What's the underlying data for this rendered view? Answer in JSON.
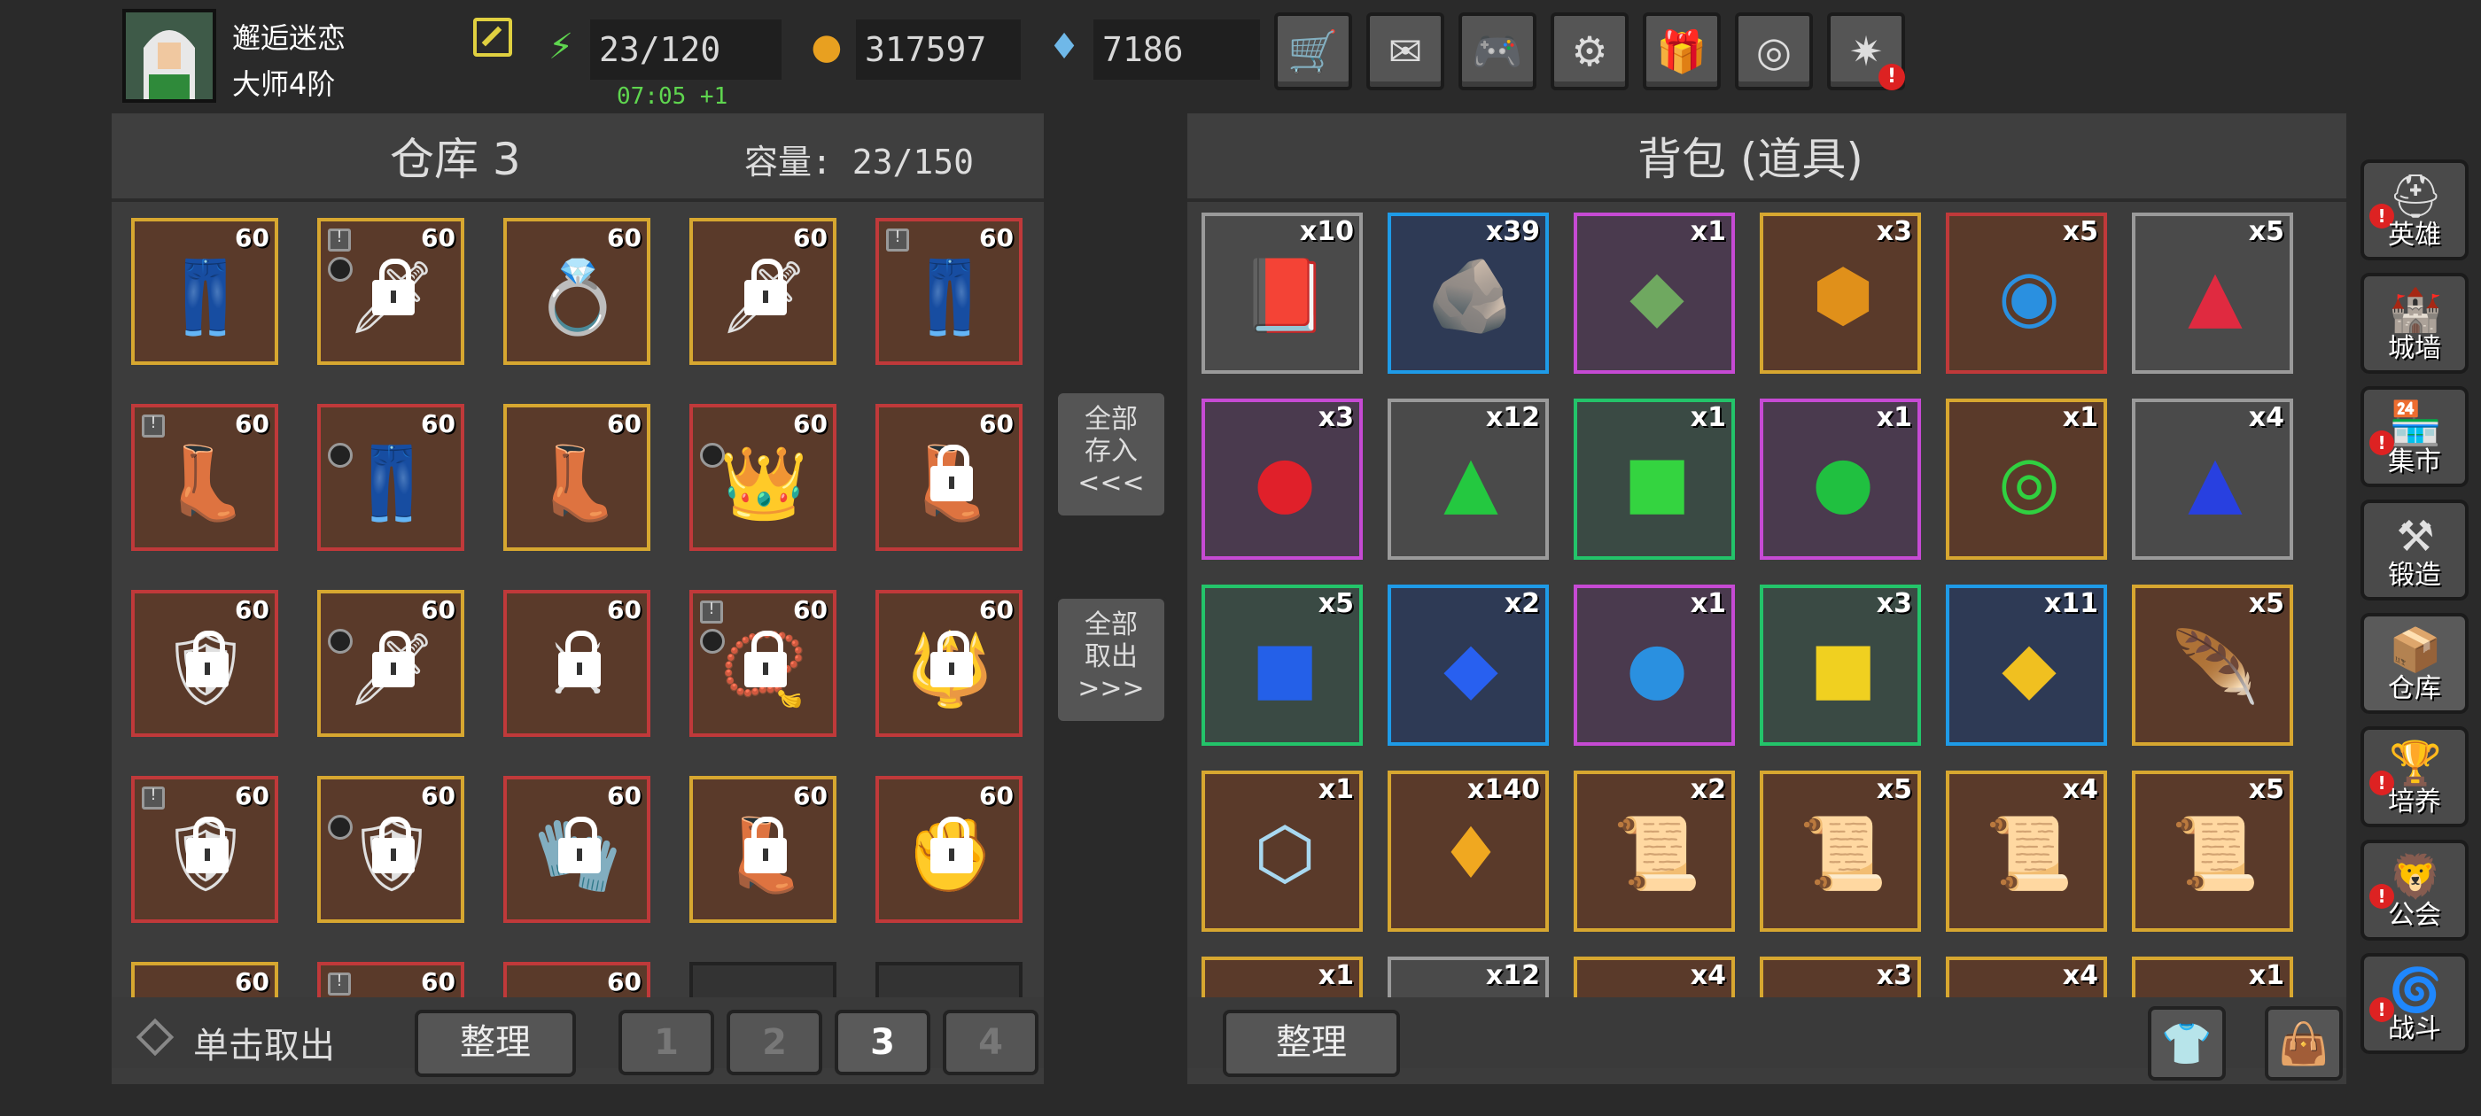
{
  "player": {
    "name": "邂逅迷恋",
    "rank": "大师4阶"
  },
  "stats": {
    "energy": "23/120",
    "gold": "317597",
    "gems": "7186",
    "timer": "07:05 +1"
  },
  "top_buttons": [
    {
      "name": "shop",
      "icon": "cart-icon"
    },
    {
      "name": "mail",
      "icon": "envelope-icon"
    },
    {
      "name": "controller",
      "icon": "gamepad-icon"
    },
    {
      "name": "settings",
      "icon": "gear-icon"
    },
    {
      "name": "gift",
      "icon": "gift-icon"
    },
    {
      "name": "camera",
      "icon": "aperture-icon"
    },
    {
      "name": "fireworks",
      "icon": "fireworks-icon"
    }
  ],
  "warehouse": {
    "title": "仓库 3",
    "capacity": "容量: 23/150",
    "slots": [
      {
        "level": "60",
        "rarity": "gold",
        "icon": "pants-icon",
        "locked": false,
        "mark": false,
        "circle": false
      },
      {
        "level": "60",
        "rarity": "gold",
        "icon": "staff-icon",
        "locked": true,
        "mark": true,
        "circle": true
      },
      {
        "level": "60",
        "rarity": "gold",
        "icon": "ring-icon",
        "locked": false,
        "mark": false,
        "circle": false
      },
      {
        "level": "60",
        "rarity": "gold",
        "icon": "staff-icon",
        "locked": true,
        "mark": false,
        "circle": false
      },
      {
        "level": "60",
        "rarity": "red",
        "icon": "pants-icon",
        "locked": false,
        "mark": true,
        "circle": false
      },
      {
        "level": "60",
        "rarity": "red",
        "icon": "boots-icon",
        "locked": false,
        "mark": true,
        "circle": false
      },
      {
        "level": "60",
        "rarity": "red",
        "icon": "pants-icon",
        "locked": false,
        "mark": false,
        "circle": true
      },
      {
        "level": "60",
        "rarity": "gold",
        "icon": "boots-icon",
        "locked": false,
        "mark": false,
        "circle": false
      },
      {
        "level": "60",
        "rarity": "red",
        "icon": "crown-icon",
        "locked": false,
        "mark": false,
        "circle": true
      },
      {
        "level": "60",
        "rarity": "red",
        "icon": "boots-icon",
        "locked": true,
        "mark": false,
        "circle": false
      },
      {
        "level": "60",
        "rarity": "red",
        "icon": "armor-icon",
        "locked": true,
        "mark": false,
        "circle": false
      },
      {
        "level": "60",
        "rarity": "gold",
        "icon": "staff-icon",
        "locked": true,
        "mark": false,
        "circle": true
      },
      {
        "level": "60",
        "rarity": "red",
        "icon": "sword-icon",
        "locked": true,
        "mark": false,
        "circle": false
      },
      {
        "level": "60",
        "rarity": "red",
        "icon": "necklace-icon",
        "locked": true,
        "mark": true,
        "circle": true
      },
      {
        "level": "60",
        "rarity": "red",
        "icon": "amulet-icon",
        "locked": true,
        "mark": false,
        "circle": false
      },
      {
        "level": "60",
        "rarity": "red",
        "icon": "armor-icon",
        "locked": true,
        "mark": true,
        "circle": false
      },
      {
        "level": "60",
        "rarity": "gold",
        "icon": "armor-icon",
        "locked": true,
        "mark": false,
        "circle": true
      },
      {
        "level": "60",
        "rarity": "red",
        "icon": "gloves-icon",
        "locked": true,
        "mark": false,
        "circle": false
      },
      {
        "level": "60",
        "rarity": "gold",
        "icon": "boots-icon",
        "locked": true,
        "mark": false,
        "circle": false
      },
      {
        "level": "60",
        "rarity": "red",
        "icon": "gauntlet-icon",
        "locked": true,
        "mark": false,
        "circle": false
      },
      {
        "level": "60",
        "rarity": "gold",
        "icon": "helmet-icon",
        "locked": false,
        "mark": false,
        "circle": false
      },
      {
        "level": "60",
        "rarity": "red",
        "icon": "armor-icon",
        "locked": false,
        "mark": true,
        "circle": false
      },
      {
        "level": "60",
        "rarity": "red",
        "icon": "helmet-icon",
        "locked": false,
        "mark": false,
        "circle": false
      },
      {
        "level": "",
        "rarity": "empty",
        "icon": "",
        "locked": false,
        "mark": false,
        "circle": false
      },
      {
        "level": "",
        "rarity": "empty",
        "icon": "",
        "locked": false,
        "mark": false,
        "circle": false
      }
    ],
    "click_take": "单击取出",
    "sort_label": "整理",
    "pages": [
      "1",
      "2",
      "3",
      "4"
    ],
    "active_page": "3"
  },
  "transfer": {
    "deposit_all": "全部\n存入\n<<<",
    "take_all": "全部\n取出\n>>>"
  },
  "backpack": {
    "title": "背包 (道具)",
    "sort_label": "整理",
    "items": [
      {
        "qty": "x10",
        "rarity": "gray",
        "icon": "book-icon",
        "glyph": "📕"
      },
      {
        "qty": "x39",
        "rarity": "blue",
        "icon": "rune-stone-icon",
        "glyph": "🪨"
      },
      {
        "qty": "x1",
        "rarity": "purple",
        "icon": "green-tablet-icon",
        "glyph": "◆"
      },
      {
        "qty": "x3",
        "rarity": "gold",
        "icon": "amber-stone-icon",
        "glyph": "⬢"
      },
      {
        "qty": "x5",
        "rarity": "red",
        "icon": "blue-orb-icon",
        "glyph": "◉"
      },
      {
        "qty": "x5",
        "rarity": "gray",
        "icon": "red-gem-icon",
        "glyph": "▲"
      },
      {
        "qty": "x3",
        "rarity": "purple",
        "icon": "red-orb-icon",
        "glyph": "●"
      },
      {
        "qty": "x12",
        "rarity": "gray",
        "icon": "green-gem-icon",
        "glyph": "▲"
      },
      {
        "qty": "x1",
        "rarity": "green",
        "icon": "green-square-gem-icon",
        "glyph": "■"
      },
      {
        "qty": "x1",
        "rarity": "purple",
        "icon": "green-orb-icon",
        "glyph": "●"
      },
      {
        "qty": "x1",
        "rarity": "gold",
        "icon": "green-ring-gem-icon",
        "glyph": "◎"
      },
      {
        "qty": "x4",
        "rarity": "gray",
        "icon": "blue-gem-icon",
        "glyph": "▲"
      },
      {
        "qty": "x5",
        "rarity": "green",
        "icon": "blue-square-gem-icon",
        "glyph": "■"
      },
      {
        "qty": "x2",
        "rarity": "blue",
        "icon": "blue-diamond-icon",
        "glyph": "◆"
      },
      {
        "qty": "x1",
        "rarity": "purple",
        "icon": "blue-orb-icon",
        "glyph": "●"
      },
      {
        "qty": "x3",
        "rarity": "green",
        "icon": "yellow-square-gem-icon",
        "glyph": "■"
      },
      {
        "qty": "x11",
        "rarity": "blue",
        "icon": "yellow-diamond-icon",
        "glyph": "◆"
      },
      {
        "qty": "x5",
        "rarity": "gold",
        "icon": "feather-icon",
        "glyph": "🪶"
      },
      {
        "qty": "x1",
        "rarity": "gold",
        "icon": "mirror-gem-icon",
        "glyph": "⬡"
      },
      {
        "qty": "x140",
        "rarity": "gold",
        "icon": "crystal-shard-icon",
        "glyph": "♦"
      },
      {
        "qty": "x2",
        "rarity": "gold",
        "icon": "scroll-icon",
        "glyph": "📜"
      },
      {
        "qty": "x5",
        "rarity": "gold",
        "icon": "scroll-icon",
        "glyph": "📜"
      },
      {
        "qty": "x4",
        "rarity": "gold",
        "icon": "scroll-icon",
        "glyph": "📜"
      },
      {
        "qty": "x5",
        "rarity": "gold",
        "icon": "scroll-icon",
        "glyph": "📜"
      },
      {
        "qty": "x1",
        "rarity": "gold",
        "icon": "scroll-icon",
        "glyph": ""
      },
      {
        "qty": "x12",
        "rarity": "gray",
        "icon": "scroll-icon",
        "glyph": ""
      },
      {
        "qty": "x4",
        "rarity": "gold",
        "icon": "scroll-icon",
        "glyph": ""
      },
      {
        "qty": "x3",
        "rarity": "gold",
        "icon": "scroll-icon",
        "glyph": ""
      },
      {
        "qty": "x4",
        "rarity": "gold",
        "icon": "scroll-icon",
        "glyph": ""
      },
      {
        "qty": "x1",
        "rarity": "gold",
        "icon": "scroll-icon",
        "glyph": ""
      }
    ]
  },
  "side_nav": [
    {
      "label": "英雄",
      "icon": "helmet-icon",
      "glyph": "⛑",
      "badge": true
    },
    {
      "label": "城墙",
      "icon": "wall-icon",
      "glyph": "🏰",
      "badge": false
    },
    {
      "label": "集市",
      "icon": "market-icon",
      "glyph": "🏪",
      "badge": true
    },
    {
      "label": "锻造",
      "icon": "anvil-icon",
      "glyph": "⚒",
      "badge": false
    },
    {
      "label": "仓库",
      "icon": "warehouse-icon",
      "glyph": "📦",
      "badge": false
    },
    {
      "label": "培养",
      "icon": "chalice-icon",
      "glyph": "🏆",
      "badge": true
    },
    {
      "label": "公会",
      "icon": "guild-icon",
      "glyph": "🦁",
      "badge": true
    },
    {
      "label": "战斗",
      "icon": "portal-icon",
      "glyph": "🌀",
      "badge": true
    }
  ],
  "colors": {
    "gold": "#d7a730",
    "red": "#c0393a",
    "blue": "#1e9be8",
    "purple": "#c64ad4",
    "green": "#23c46a",
    "gray": "#9a9a9a"
  }
}
